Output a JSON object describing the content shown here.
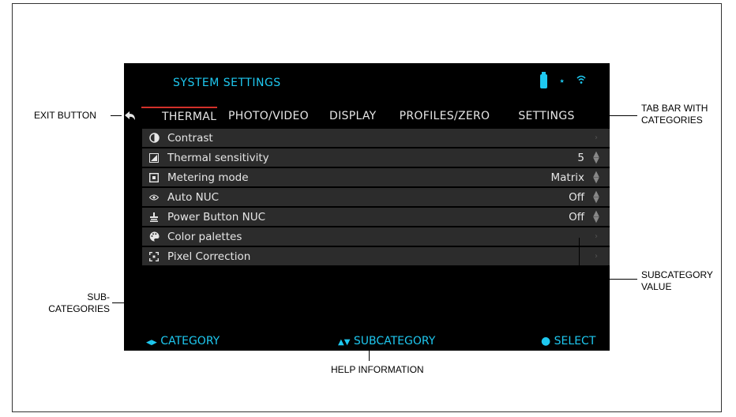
{
  "screen": {
    "title": "SYSTEM SETTINGS",
    "tabs": [
      "THERMAL",
      "PHOTO/VIDEO",
      "DISPLAY",
      "PROFILES/ZERO",
      "SETTINGS"
    ],
    "active_tab": "THERMAL",
    "items": [
      {
        "icon": "contrast-icon",
        "label": "Contrast",
        "value": "",
        "control": "chevron"
      },
      {
        "icon": "thermal-sensitivity-icon",
        "label": "Thermal sensitivity",
        "value": "5",
        "control": "stepper"
      },
      {
        "icon": "metering-icon",
        "label": "Metering mode",
        "value": "Matrix",
        "control": "stepper"
      },
      {
        "icon": "eye-icon",
        "label": "Auto NUC",
        "value": "Off",
        "control": "stepper"
      },
      {
        "icon": "power-nuc-icon",
        "label": "Power Button NUC",
        "value": "Off",
        "control": "stepper"
      },
      {
        "icon": "palette-icon",
        "label": "Color palettes",
        "value": "",
        "control": "chevron"
      },
      {
        "icon": "pixel-correction-icon",
        "label": "Pixel Correction",
        "value": "",
        "control": "chevron"
      }
    ],
    "help": {
      "category": "CATEGORY",
      "subcategory": "SUBCATEGORY",
      "select": "SELECT"
    }
  },
  "annotations": {
    "exit_button": "EXIT BUTTON",
    "tab_bar_line1": "TAB BAR WITH",
    "tab_bar_line2": "CATEGORIES",
    "sub_line1": "SUB-",
    "sub_line2": "CATEGORIES",
    "subcat_value_line1": "SUBCATEGORY",
    "subcat_value_line2": "VALUE",
    "help_information": "HELP INFORMATION"
  },
  "colors": {
    "accent": "#1ec8f0",
    "active_tab_border": "#d3312a",
    "row_bg": "#2c2c2c"
  }
}
